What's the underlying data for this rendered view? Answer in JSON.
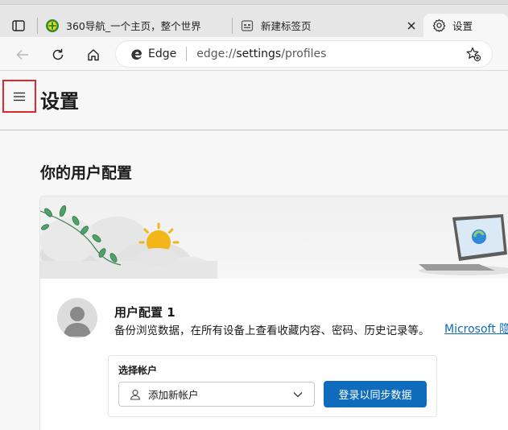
{
  "tabs": [
    {
      "label": "360导航_一个主页，整个世界",
      "icon": "360-nav-icon"
    },
    {
      "label": "新建标签页",
      "icon": "new-tab-page-icon"
    },
    {
      "label": "设置",
      "icon": "gear-icon",
      "active": true
    }
  ],
  "address_bar": {
    "site_name": "Edge",
    "url_prefix": "edge://",
    "url_host": "settings",
    "url_path": "/profiles"
  },
  "settings": {
    "page_title": "设置",
    "section_title": "你的用户配置",
    "profile": {
      "name": "用户配置 1",
      "description": "备份浏览数据，在所有设备上查看收藏内容、密码、历史记录等。",
      "link_text": "Microsoft 隐"
    },
    "account": {
      "label": "选择帐户",
      "select_value": "添加新帐户",
      "sync_button": "登录以同步数据"
    }
  },
  "colors": {
    "accent": "#0f6cbd",
    "highlight_border": "#e0262b"
  }
}
